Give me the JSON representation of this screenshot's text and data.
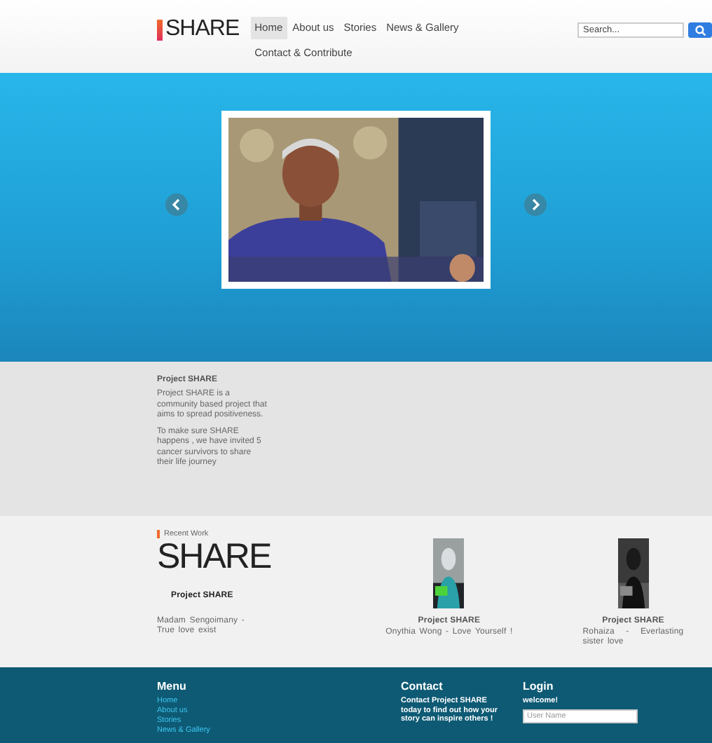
{
  "header": {
    "logo": "SHARE",
    "nav": [
      {
        "label": "Home",
        "selected": true
      },
      {
        "label": "About us",
        "selected": false
      },
      {
        "label": "Stories",
        "selected": false
      },
      {
        "label": "News & Gallery",
        "selected": false
      },
      {
        "label": "Contact & Contribute",
        "selected": false
      }
    ],
    "search": {
      "placeholder": "Search..."
    }
  },
  "about": {
    "title": "Project SHARE",
    "paragraphs": [
      "Project SHARE is a community based project that aims to spread positiveness.",
      "To make sure SHARE happens , we have invited 5 cancer survivors to share their life journey"
    ]
  },
  "recent": {
    "heading": "Recent Work",
    "items": [
      {
        "kind": "logo",
        "logo": "SHARE",
        "title": "Project SHARE",
        "caption": "Madam Sengoimany - True love exist"
      },
      {
        "kind": "picture",
        "title": "Project SHARE",
        "caption": "Onythia Wong - Love Yourself !"
      },
      {
        "kind": "picture",
        "title": "Project SHARE",
        "caption": "Rohaiza - Everlasting sister love"
      }
    ]
  },
  "footer": {
    "menu": {
      "title": "Menu",
      "links": [
        "Home",
        "About us",
        "Stories",
        "News & Gallery"
      ]
    },
    "contact": {
      "title": "Contact",
      "text": "Contact Project SHARE today to find out how your story can inspire others !"
    },
    "login": {
      "title": "Login",
      "greeting": "welcome!",
      "username_placeholder": "User Name"
    }
  }
}
